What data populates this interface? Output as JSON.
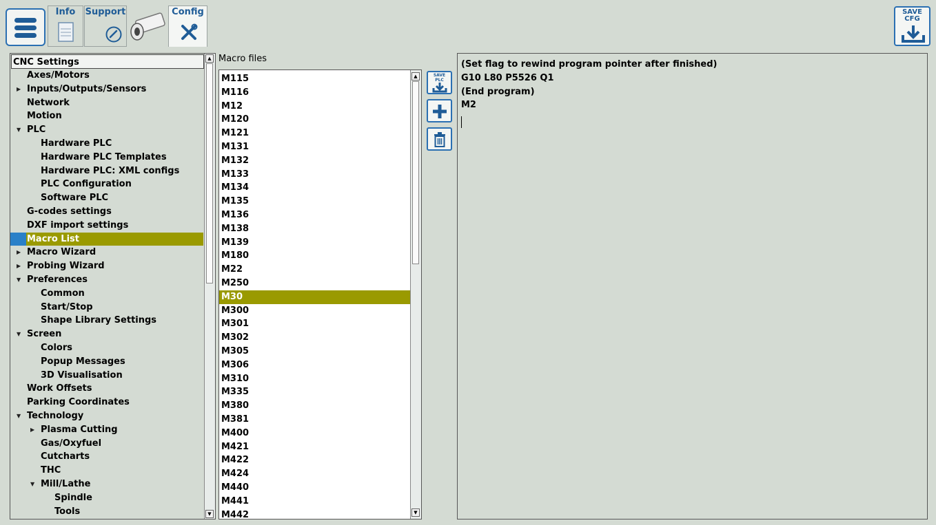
{
  "toolbar": {
    "tabs": [
      {
        "label": "Info"
      },
      {
        "label": "Support"
      },
      {
        "label": "Config"
      }
    ],
    "save_cfg_line1": "SAVE",
    "save_cfg_line2": "CFG"
  },
  "tree": {
    "header": "CNC Settings",
    "items": [
      {
        "label": "Axes/Motors",
        "level": 0,
        "arrow": ""
      },
      {
        "label": "Inputs/Outputs/Sensors",
        "level": 0,
        "arrow": "collapsed"
      },
      {
        "label": "Network",
        "level": 0,
        "arrow": ""
      },
      {
        "label": "Motion",
        "level": 0,
        "arrow": ""
      },
      {
        "label": "PLC",
        "level": 0,
        "arrow": "expanded"
      },
      {
        "label": "Hardware PLC",
        "level": 1,
        "arrow": ""
      },
      {
        "label": "Hardware PLC Templates",
        "level": 1,
        "arrow": ""
      },
      {
        "label": "Hardware PLC: XML configs",
        "level": 1,
        "arrow": ""
      },
      {
        "label": "PLC Configuration",
        "level": 1,
        "arrow": ""
      },
      {
        "label": "Software PLC",
        "level": 1,
        "arrow": ""
      },
      {
        "label": "G-codes settings",
        "level": 0,
        "arrow": ""
      },
      {
        "label": "DXF import settings",
        "level": 0,
        "arrow": ""
      },
      {
        "label": "Macro List",
        "level": 0,
        "arrow": "",
        "selected": true
      },
      {
        "label": "Macro Wizard",
        "level": 0,
        "arrow": "collapsed"
      },
      {
        "label": "Probing Wizard",
        "level": 0,
        "arrow": "collapsed"
      },
      {
        "label": "Preferences",
        "level": 0,
        "arrow": "expanded"
      },
      {
        "label": "Common",
        "level": 1,
        "arrow": ""
      },
      {
        "label": "Start/Stop",
        "level": 1,
        "arrow": ""
      },
      {
        "label": "Shape Library Settings",
        "level": 1,
        "arrow": ""
      },
      {
        "label": "Screen",
        "level": 0,
        "arrow": "expanded"
      },
      {
        "label": "Colors",
        "level": 1,
        "arrow": ""
      },
      {
        "label": "Popup Messages",
        "level": 1,
        "arrow": ""
      },
      {
        "label": "3D Visualisation",
        "level": 1,
        "arrow": ""
      },
      {
        "label": "Work Offsets",
        "level": 0,
        "arrow": ""
      },
      {
        "label": "Parking Coordinates",
        "level": 0,
        "arrow": ""
      },
      {
        "label": "Technology",
        "level": 0,
        "arrow": "expanded"
      },
      {
        "label": "Plasma Cutting",
        "level": 1,
        "arrow": "collapsed"
      },
      {
        "label": "Gas/Oxyfuel",
        "level": 1,
        "arrow": ""
      },
      {
        "label": "Cutcharts",
        "level": 1,
        "arrow": ""
      },
      {
        "label": "THC",
        "level": 1,
        "arrow": ""
      },
      {
        "label": "Mill/Lathe",
        "level": 1,
        "arrow": "expanded"
      },
      {
        "label": "Spindle",
        "level": 2,
        "arrow": ""
      },
      {
        "label": "Tools",
        "level": 2,
        "arrow": ""
      }
    ]
  },
  "macro_files": {
    "title": "Macro files",
    "items": [
      "M115",
      "M116",
      "M12",
      "M120",
      "M121",
      "M131",
      "M132",
      "M133",
      "M134",
      "M135",
      "M136",
      "M138",
      "M139",
      "M180",
      "M22",
      "M250",
      "M30",
      "M300",
      "M301",
      "M302",
      "M305",
      "M306",
      "M310",
      "M335",
      "M380",
      "M381",
      "M400",
      "M421",
      "M422",
      "M424",
      "M440",
      "M441",
      "M442"
    ],
    "selected": "M30"
  },
  "side_buttons": {
    "save_plc_line1": "SAVE",
    "save_plc_line2": "PLC"
  },
  "editor": {
    "lines": [
      "(Set flag to rewind program pointer after finished)",
      "G10 L80 P5526 Q1",
      "(End program)",
      "M2"
    ]
  },
  "colors": {
    "background": "#d4dbd3",
    "accent_blue": "#2a6fb2",
    "selection": "#9a9a00"
  }
}
